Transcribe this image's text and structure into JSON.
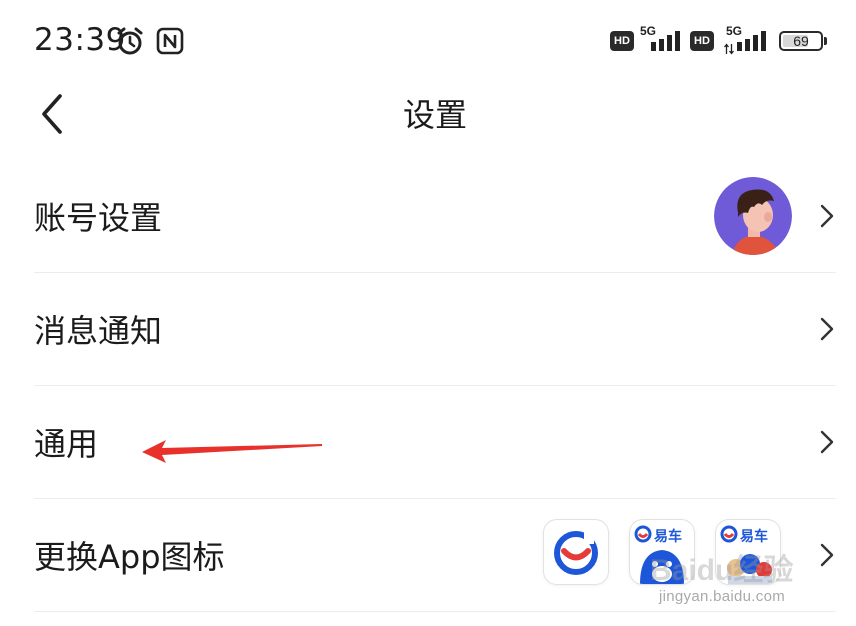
{
  "status_bar": {
    "time": "23:39",
    "network_1": "5G",
    "network_2": "5G",
    "hd_1": "HD",
    "hd_2": "HD",
    "battery_level": "69",
    "icons": [
      "alarm-clock-icon",
      "nfc-icon",
      "signal-icon",
      "battery-icon"
    ]
  },
  "header": {
    "title": "设置",
    "back_icon": "chevron-left-icon"
  },
  "settings": {
    "items": [
      {
        "label": "账号设置"
      },
      {
        "label": "消息通知"
      },
      {
        "label": "通用"
      },
      {
        "label": "更换App图标"
      }
    ]
  },
  "app_icons": {
    "option_2_text": "易车",
    "option_3_text": "易车"
  },
  "annotation": {
    "arrow_color": "#e8312a"
  },
  "watermark": {
    "brand": "Baidu经验",
    "url": "jingyan.baidu.com"
  },
  "colors": {
    "avatar_bg": "#6f5bd8",
    "brand_blue": "#1d56d8",
    "brand_red": "#e53a3a"
  }
}
